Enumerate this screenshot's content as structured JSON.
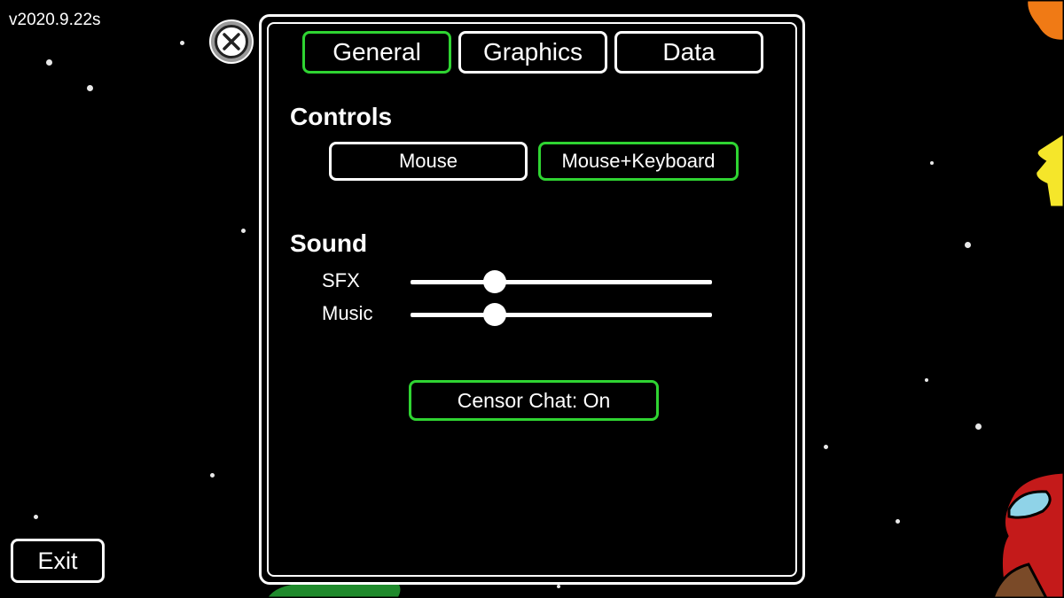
{
  "version": "v2020.9.22s",
  "exit_label": "Exit",
  "close_icon": "close-icon",
  "tabs": [
    {
      "label": "General",
      "active": true
    },
    {
      "label": "Graphics",
      "active": false
    },
    {
      "label": "Data",
      "active": false
    }
  ],
  "controls": {
    "title": "Controls",
    "options": [
      {
        "label": "Mouse",
        "active": false
      },
      {
        "label": "Mouse+Keyboard",
        "active": true
      }
    ]
  },
  "sound": {
    "title": "Sound",
    "sliders": [
      {
        "label": "SFX",
        "value": 0.28
      },
      {
        "label": "Music",
        "value": 0.28
      }
    ]
  },
  "censor_chat_label": "Censor Chat: On",
  "colors": {
    "accent": "#2fd432",
    "background": "#000000",
    "foreground": "#ffffff"
  }
}
